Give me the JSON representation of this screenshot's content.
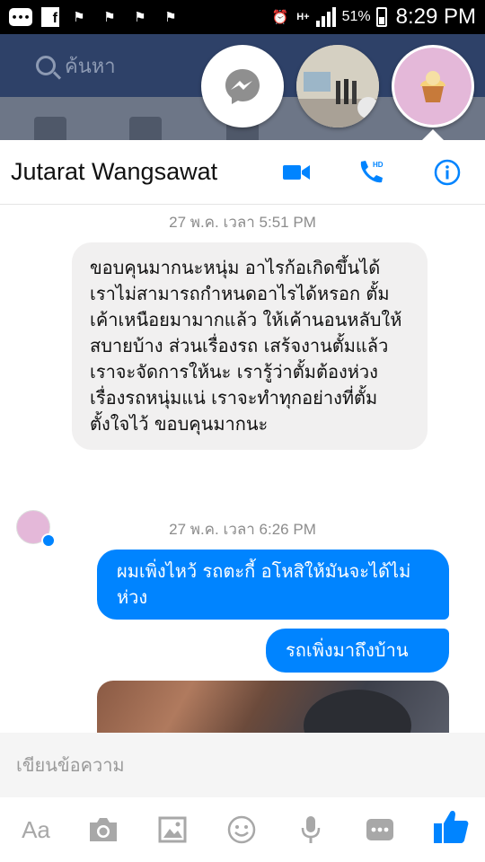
{
  "status_bar": {
    "battery": "51%",
    "time": "8:29 PM",
    "network": "H+"
  },
  "background_app": {
    "search_placeholder": "ค้นหา"
  },
  "chat": {
    "contact_name": "Jutarat Wangsawat",
    "messages": [
      {
        "type": "timestamp",
        "text": "27 พ.ค. เวลา 5:51 PM"
      },
      {
        "type": "incoming",
        "text": "ขอบคุนมากนะหนุ่ม อาไรก้อเกิดขึ้นได้ เราไม่สามารถกำหนดอาไรได้หรอก ตั้มเค้าเหนือยมามากแล้ว ให้เค้านอนหลับให้สบายบ้าง  ส่วนเรื่องรถ เสร้จงานตั้มแล้วเราจะจัดการให้นะ เรารู้ว่าตั้มต้องห่วงเรื่องรถหนุ่มแน่ เราจะทำทุกอย่างที่ตั้มตั้งใจไว้ ขอบคุนมากนะ"
      },
      {
        "type": "timestamp",
        "text": "27 พ.ค. เวลา 6:26 PM"
      },
      {
        "type": "outgoing",
        "text": "ผมเพิ่งไหว้ รถตะกี้ อโหสิให้มันจะได้ไม่ห่วง"
      },
      {
        "type": "outgoing",
        "text": "รถเพิ่งมาถึงบ้าน"
      }
    ],
    "composer_placeholder": "เขียนข้อความ",
    "toolbar": {
      "text_format_label": "Aa"
    }
  },
  "colors": {
    "accent": "#0084ff",
    "incoming_bubble": "#f1f0f0",
    "header_bg": "#2e4168"
  },
  "icons": [
    "messenger-icon",
    "video-call-icon",
    "hd-phone-icon",
    "info-icon",
    "camera-icon",
    "gallery-icon",
    "emoji-icon",
    "microphone-icon",
    "more-icon",
    "like-icon"
  ]
}
